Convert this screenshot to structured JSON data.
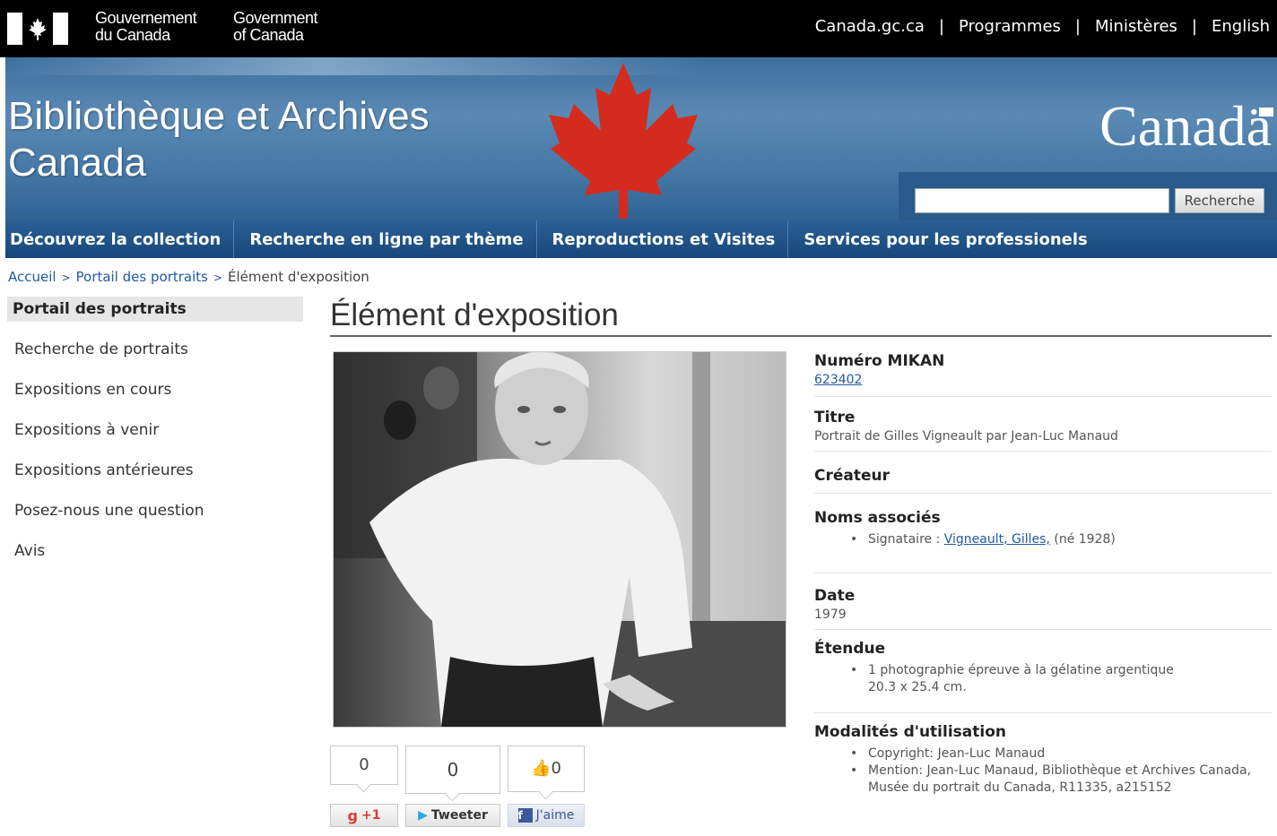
{
  "fip": {
    "gov_fr_line1": "Gouvernement",
    "gov_fr_line2": "du Canada",
    "gov_en_line1": "Government",
    "gov_en_line2": "of Canada",
    "links": [
      "Canada.gc.ca",
      "Programmes",
      "Ministères",
      "English"
    ]
  },
  "banner": {
    "title_line1": "Bibliothèque et Archives",
    "title_line2": "Canada",
    "wordmark": "Canadä",
    "search_button": "Recherche",
    "search_value": ""
  },
  "mainnav": [
    "Découvrez la collection",
    "Recherche en ligne par thème",
    "Reproductions et Visites",
    "Services pour les professionels"
  ],
  "breadcrumb": {
    "home": "Accueil",
    "portal": "Portail des portraits",
    "current": "Élément d'exposition"
  },
  "leftnav": {
    "header": "Portail des portraits",
    "items": [
      "Recherche de portraits",
      "Expositions en cours",
      "Expositions à venir",
      "Expositions antérieures",
      "Posez-nous une question",
      "Avis"
    ]
  },
  "page_title": "Élément d'exposition",
  "social": {
    "gplus_count": "0",
    "gplus_label": "+1",
    "tweet_count": "0",
    "tweet_label": "Tweeter",
    "fb_count": "0",
    "fb_label": "J'aime"
  },
  "details": {
    "mikan_label": "Numéro MIKAN",
    "mikan_value": "623402",
    "titre_label": "Titre",
    "titre_value": "Portrait de Gilles Vigneault par Jean-Luc Manaud",
    "createur_label": "Créateur",
    "noms_label": "Noms associés",
    "noms_prefix": "Signataire : ",
    "noms_link": "Vigneault, Gilles,",
    "noms_suffix": " (né 1928)",
    "date_label": "Date",
    "date_value": "1979",
    "etendue_label": "Étendue",
    "etendue_line1": "1 photographie épreuve à la gélatine argentique",
    "etendue_line2": "20.3 x 25.4 cm.",
    "modalites_label": "Modalités d'utilisation",
    "modalites_1": "Copyright: Jean-Luc Manaud",
    "modalites_2": "Mention: Jean-Luc Manaud, Bibliothèque et Archives Canada, Musée du portrait du Canada, R11335, a215152"
  },
  "colors": {
    "fip_bg": "#000000",
    "banner_blue": "#4678a6",
    "nav_blue": "#1f5290",
    "leaf_red": "#d52b1e",
    "link_blue": "#1f5aa6"
  }
}
